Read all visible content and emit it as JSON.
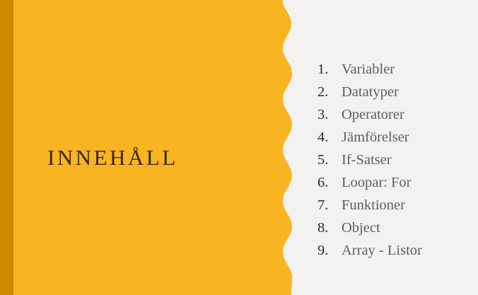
{
  "slide": {
    "title": "INNEHÅLL",
    "colors": {
      "panel": "#f9b422",
      "stripe": "#cc8a05",
      "background": "#f3f2f0",
      "title": "#3a2418",
      "item_text": "#5e5e5e"
    },
    "items": [
      {
        "num": "1.",
        "text": "Variabler"
      },
      {
        "num": "2.",
        "text": "Datatyper"
      },
      {
        "num": "3.",
        "text": "Operatorer"
      },
      {
        "num": "4.",
        "text": "Jämförelser"
      },
      {
        "num": "5.",
        "text": "If-Satser"
      },
      {
        "num": "6.",
        "text": "Loopar: For"
      },
      {
        "num": "7.",
        "text": "Funktioner"
      },
      {
        "num": "8.",
        "text": "Object"
      },
      {
        "num": "9.",
        "text": "Array - Listor"
      }
    ]
  }
}
